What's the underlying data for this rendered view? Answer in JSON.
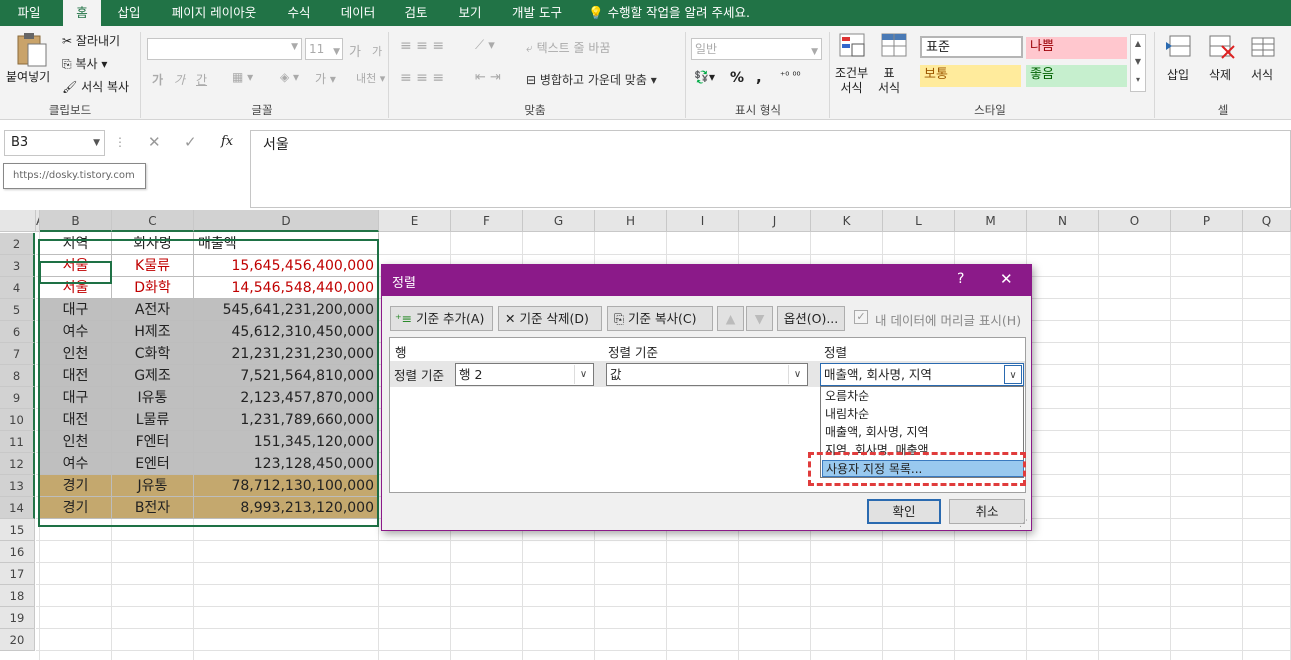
{
  "tabs": [
    "파일",
    "홈",
    "삽입",
    "페이지 레이아웃",
    "수식",
    "데이터",
    "검토",
    "보기",
    "개발 도구"
  ],
  "tell_me": "수행할 작업을 알려 주세요.",
  "ribbon": {
    "clipboard": {
      "paste": "붙여넣기",
      "cut": "잘라내기",
      "copy": "복사",
      "format_painter": "서식 복사",
      "label": "클립보드"
    },
    "font": {
      "font_size": "11",
      "grow": "가",
      "shrink": "가",
      "bold": "가",
      "italic": "가",
      "underline": "간",
      "phonetic": "내천",
      "label": "글꼴"
    },
    "align": {
      "wrap": "텍스트 줄 바꿈",
      "merge": "병합하고 가운데 맞춤",
      "label": "맞춤"
    },
    "number": {
      "format": "일반",
      "percent": "%",
      "comma": ",",
      "label": "표시 형식"
    },
    "styles": {
      "conditional": "조건부\n서식",
      "table": "표\n서식",
      "normal": "표준",
      "bad": "나쁨",
      "neutral": "보통",
      "good": "좋음",
      "label": "스타일"
    },
    "cells": {
      "insert": "삽입",
      "delete": "삭제",
      "format": "서식",
      "label": "셀"
    }
  },
  "formula_bar": {
    "name_box": "B3",
    "fx": "fx",
    "value": "서울",
    "tooltip": "https://dosky.tistory.com"
  },
  "columns": [
    "A",
    "B",
    "C",
    "D",
    "E",
    "F",
    "G",
    "H",
    "I",
    "J",
    "K",
    "L",
    "M",
    "N",
    "O",
    "P",
    "Q"
  ],
  "rows": [
    "2",
    "3",
    "4",
    "5",
    "6",
    "7",
    "8",
    "9",
    "10",
    "11",
    "12",
    "13",
    "14",
    "15",
    "16",
    "17",
    "18",
    "19",
    "20"
  ],
  "table": [
    {
      "b": "지역",
      "c": "회사명",
      "d": "매출액",
      "style": "header"
    },
    {
      "b": "서울",
      "c": "K물류",
      "d": "15,645,456,400,000",
      "style": "red"
    },
    {
      "b": "서울",
      "c": "D화학",
      "d": "14,546,548,440,000",
      "style": "red"
    },
    {
      "b": "대구",
      "c": "A전자",
      "d": "545,641,231,200,000",
      "style": "gray"
    },
    {
      "b": "여수",
      "c": "H제조",
      "d": "45,612,310,450,000",
      "style": "gray"
    },
    {
      "b": "인천",
      "c": "C화학",
      "d": "21,231,231,230,000",
      "style": "gray"
    },
    {
      "b": "대전",
      "c": "G제조",
      "d": "7,521,564,810,000",
      "style": "gray"
    },
    {
      "b": "대구",
      "c": "I유통",
      "d": "2,123,457,870,000",
      "style": "gray"
    },
    {
      "b": "대전",
      "c": "L물류",
      "d": "1,231,789,660,000",
      "style": "gray"
    },
    {
      "b": "인천",
      "c": "F엔터",
      "d": "151,345,120,000",
      "style": "gray"
    },
    {
      "b": "여수",
      "c": "E엔터",
      "d": "123,128,450,000",
      "style": "gray"
    },
    {
      "b": "경기",
      "c": "J유통",
      "d": "78,712,130,100,000",
      "style": "tan"
    },
    {
      "b": "경기",
      "c": "B전자",
      "d": "8,993,213,120,000",
      "style": "tan"
    }
  ],
  "dialog": {
    "title": "정렬",
    "help": "?",
    "close": "✕",
    "add_level": "기준 추가(A)",
    "delete_level": "기준 삭제(D)",
    "copy_level": "기준 복사(C)",
    "options": "옵션(O)...",
    "has_header": "내 데이터에 머리글 표시(H)",
    "col_row": "행",
    "col_sorton": "정렬 기준",
    "col_order": "정렬",
    "row_label": "정렬 기준",
    "row_value": "행 2",
    "sorton_value": "값",
    "order_value": "매출액, 회사명, 지역",
    "order_options": [
      "오름차순",
      "내림차순",
      "매출액, 회사명, 지역",
      "지역, 회사명, 매출액",
      "사용자 지정 목록..."
    ],
    "ok": "확인",
    "cancel": "취소"
  },
  "colors": {
    "brand": "#217346",
    "dialog": "#8b1a89",
    "gray_fill": "#bfbfbf",
    "tan_fill": "#c4a86e",
    "red_text": "#c00000",
    "highlight": "#e03c3c"
  }
}
